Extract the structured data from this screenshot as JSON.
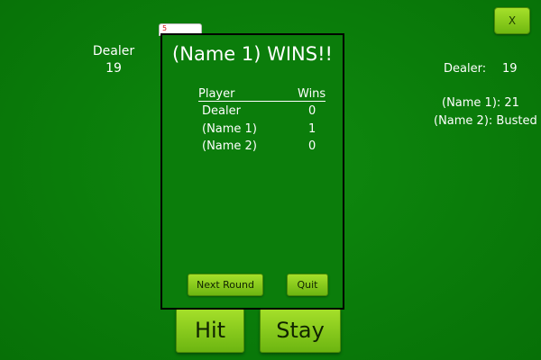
{
  "window": {
    "close_label": "X"
  },
  "dealer_hand": {
    "label": "Dealer",
    "total": "19"
  },
  "card_peek": {
    "rank": "5"
  },
  "scoreboard": {
    "dealer": {
      "label": "Dealer:",
      "value": "19"
    },
    "players": [
      {
        "text": "(Name 1): 21"
      },
      {
        "text": "(Name 2): Busted"
      }
    ]
  },
  "actions": {
    "hit_label": "Hit",
    "stay_label": "Stay"
  },
  "dialog": {
    "title": "(Name 1) WINS!!",
    "headers": {
      "player": "Player",
      "wins": "Wins"
    },
    "rows": [
      {
        "name": "Dealer",
        "wins": "0"
      },
      {
        "name": "(Name 1)",
        "wins": "1"
      },
      {
        "name": "(Name 2)",
        "wins": "0"
      }
    ],
    "next_round_label": "Next Round",
    "quit_label": "Quit"
  }
}
